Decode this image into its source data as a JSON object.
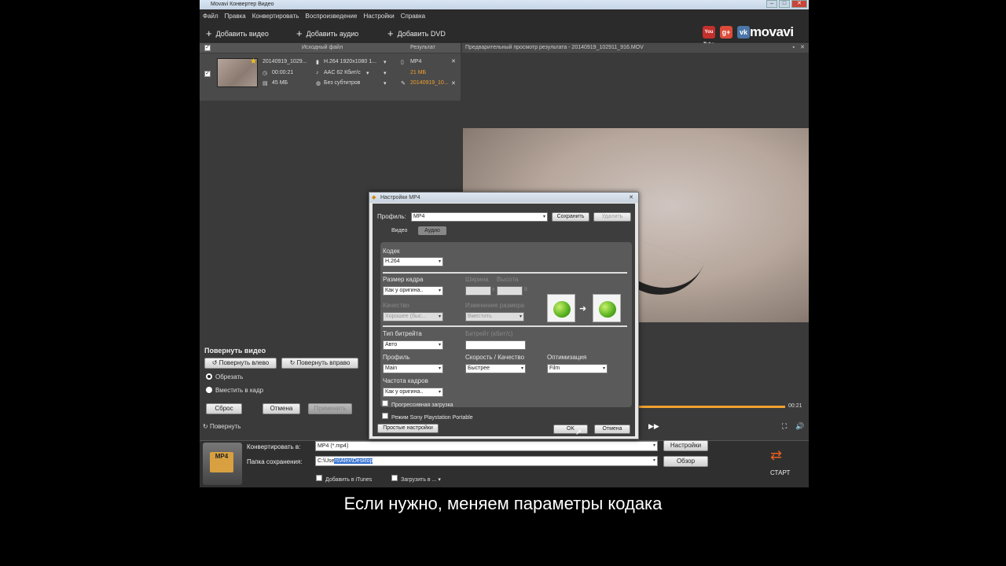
{
  "window": {
    "title": "Movavi Конвертер Видео"
  },
  "menu": [
    "Файл",
    "Правка",
    "Конвертировать",
    "Воспроизведение",
    "Настройки",
    "Справка"
  ],
  "toolbar": {
    "add_video": "Добавить видео",
    "add_audio": "Добавить аудио",
    "add_dvd": "Добавить DVD",
    "logo": "movavi",
    "youtube": "You Tube"
  },
  "file_list": {
    "col_source": "Исходный файл",
    "col_result": "Результат",
    "item": {
      "name": "20140919_1029...",
      "duration": "00:00:21",
      "size": "45 МБ",
      "video": "H.264 1920x1080 1...",
      "audio": "AAC 62 Кбит/с",
      "subtitles": "Без субтитров",
      "out_format": "MP4",
      "out_size": "21 МБ",
      "out_name": "20140919_10..."
    }
  },
  "rotate": {
    "title": "Повернуть видео",
    "left": "Повернуть влево",
    "right": "Повернуть вправо",
    "crop": "Обрезать",
    "fit": "Вместить в кадр",
    "reset": "Сброс",
    "cancel": "Отмена",
    "apply": "Применить",
    "rotate_link": "Повернуть"
  },
  "preview": {
    "header": "Предварительный просмотр результата - 20140919_102911_916.MOV",
    "time": "00:21"
  },
  "bottom": {
    "convert_label": "Конвертировать в:",
    "convert_value": "MP4 (*.mp4)",
    "settings": "Настройки",
    "folder_label": "Папка сохранения:",
    "folder_prefix": "C:\\Use",
    "folder_selected": "rs\\Alex\\Desktop",
    "browse": "Обзор",
    "itunes": "Добавить в iTunes",
    "upload": "Загрузить в ...",
    "start": "СТАРТ",
    "mp4_badge": "MP4"
  },
  "dialog": {
    "title": "Настройки MP4",
    "profile_label": "Профиль:",
    "profile_value": "MP4",
    "save": "Сохранить",
    "delete": "Удалить",
    "tab_video": "Видео",
    "tab_audio": "Аудио",
    "codec_label": "Кодек",
    "codec_value": "H.264",
    "frame_label": "Размер кадра",
    "frame_value": "Как у оригина..",
    "width_label": "Ширина",
    "height_label": "Высота",
    "quality_label": "Качество",
    "quality_value": "Хорошее (быс...",
    "resize_label": "Изменение размера",
    "resize_value": "Вместить",
    "bitrate_type_label": "Тип битрейта",
    "bitrate_type_value": "Авто",
    "bitrate_label": "Битрейт (кбит/с)",
    "profile2_label": "Профиль",
    "profile2_value": "Main",
    "speed_label": "Скорость / Качество",
    "speed_value": "Быстрее",
    "opt_label": "Оптимизация",
    "opt_value": "Film",
    "fps_label": "Частота кадров",
    "fps_value": "Как у оригина..",
    "progressive": "Прогрессивная загрузка",
    "sony": "Режим Sony Playstation Portable",
    "simple": "Простые настройки",
    "ok": "OK",
    "cancel": "Отмена"
  },
  "caption": "Если нужно, меняем параметры кодака"
}
